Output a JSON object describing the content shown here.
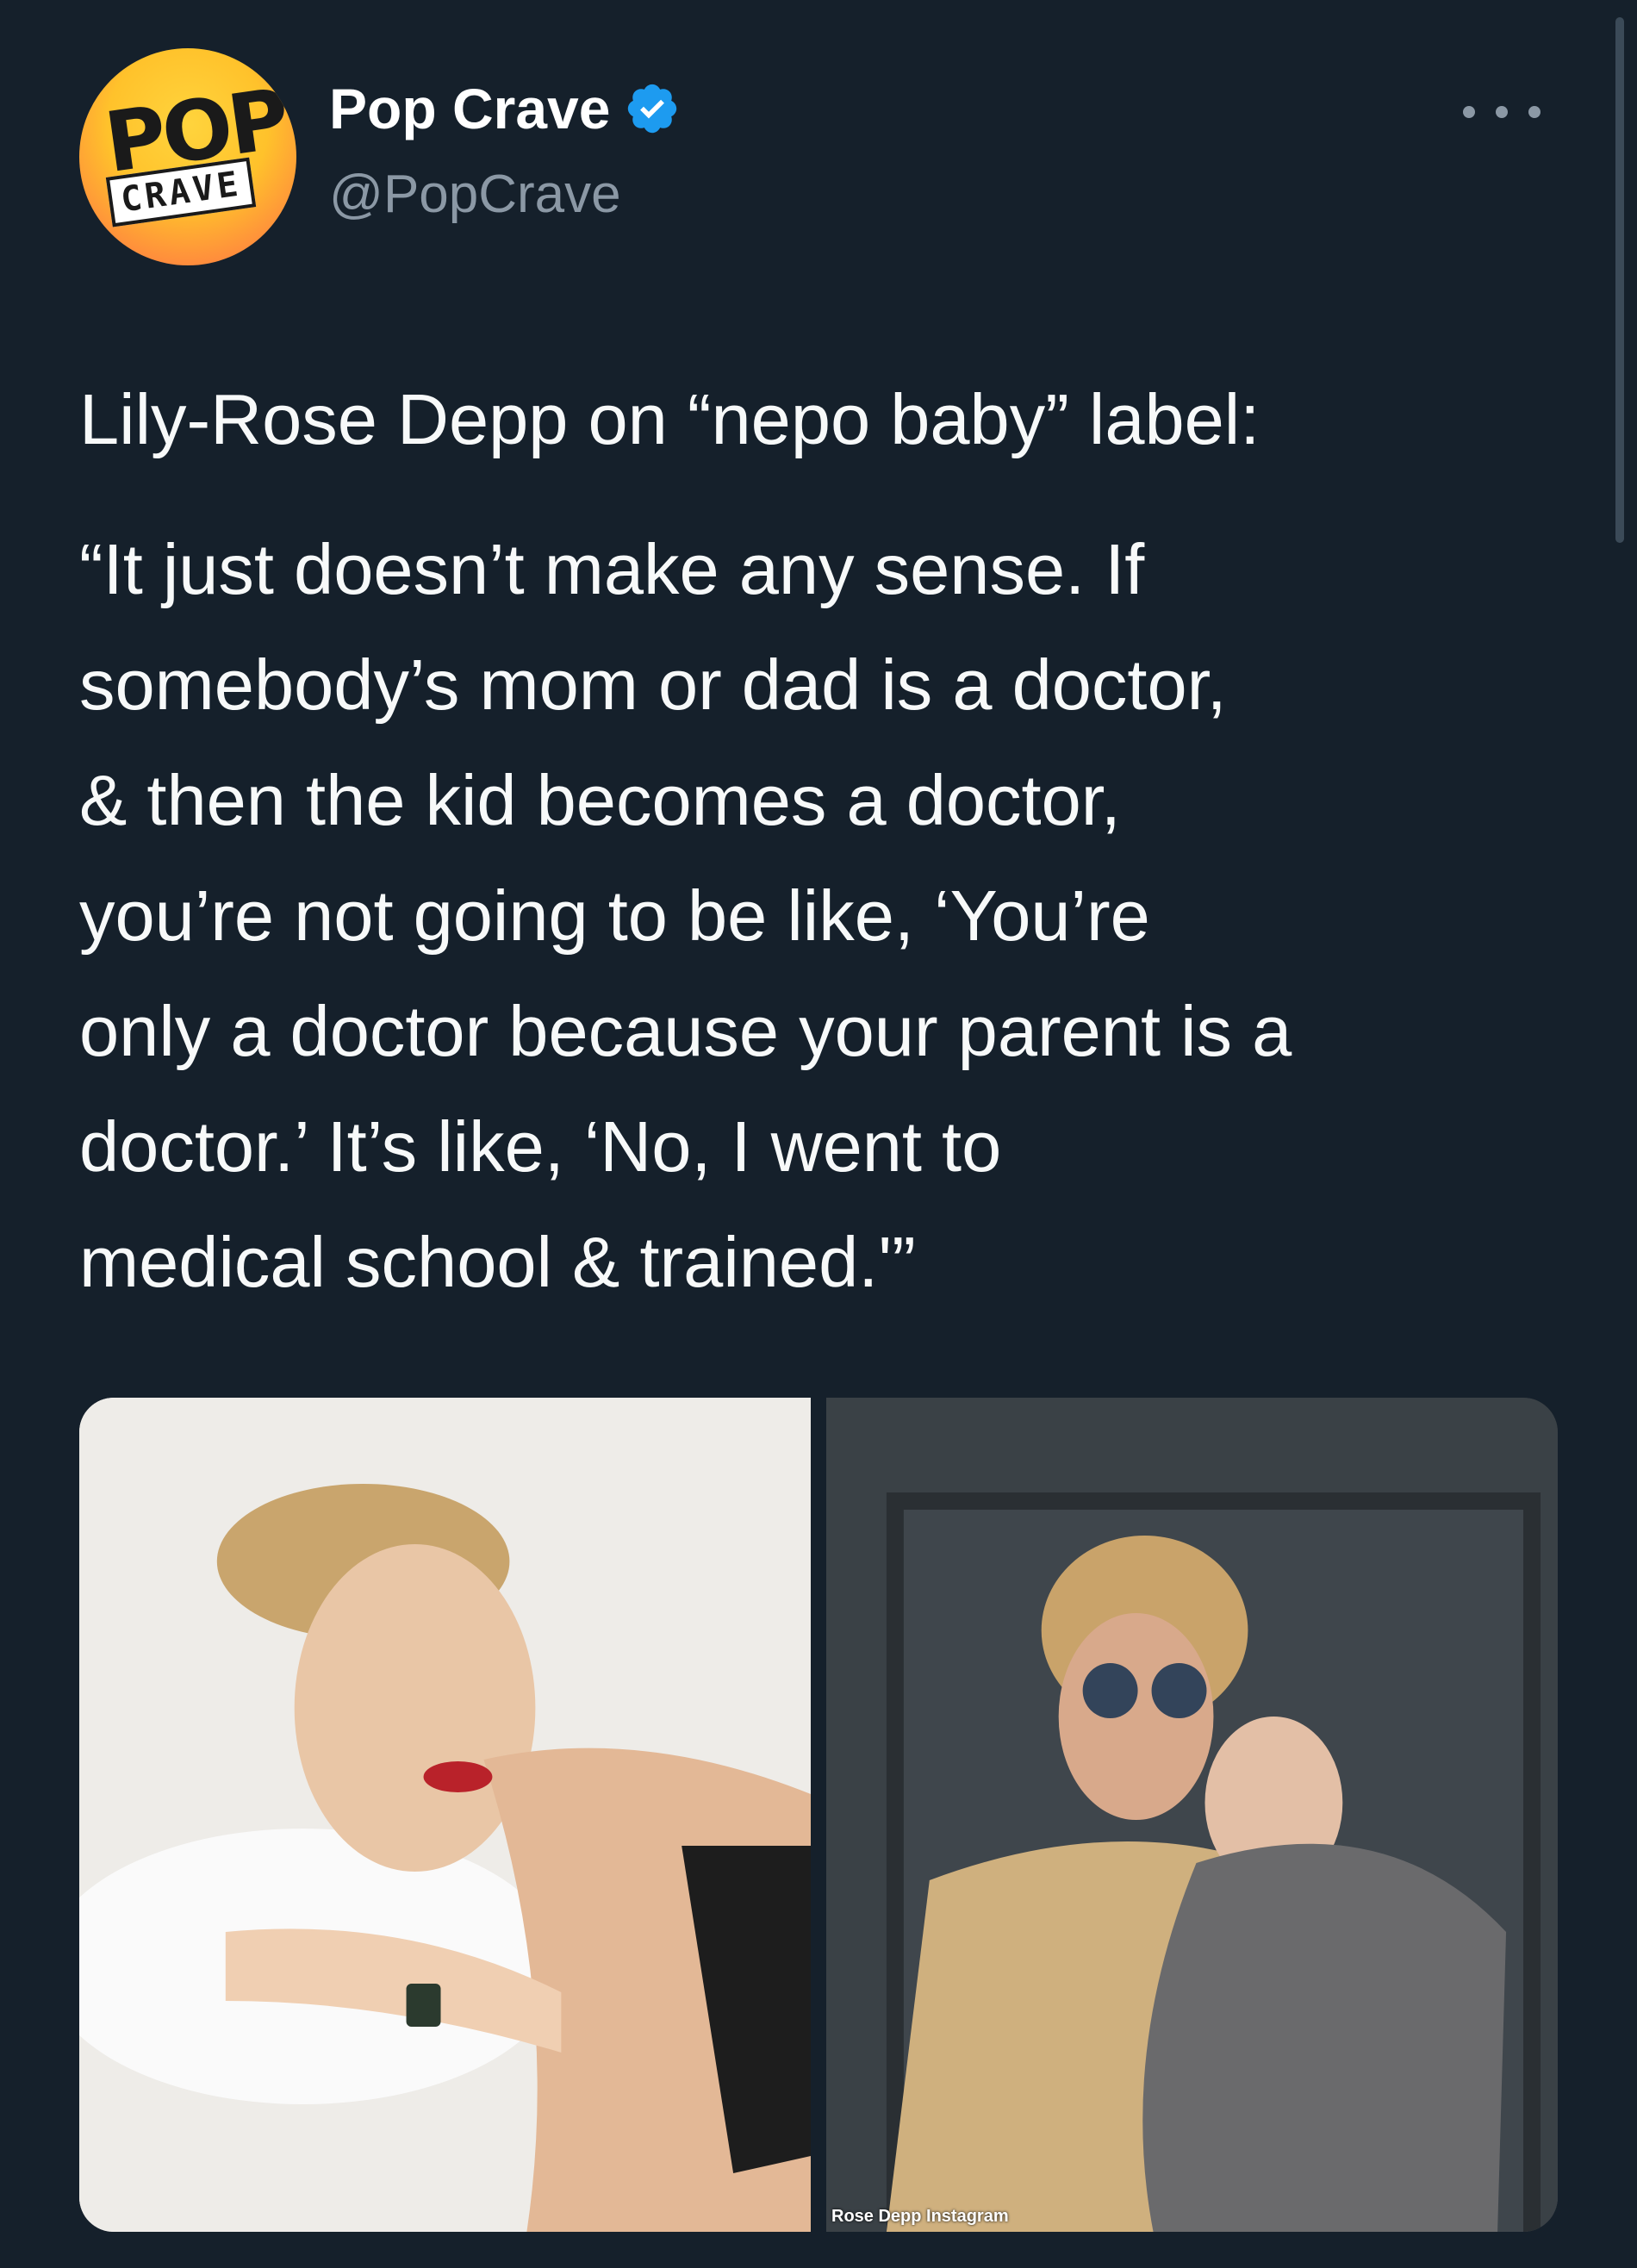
{
  "author": {
    "display_name": "Pop Crave",
    "handle": "@PopCrave",
    "avatar_text_top": "POP",
    "avatar_text_bottom": "CRAVE",
    "verified": true
  },
  "tweet": {
    "lead": "Lily-Rose Depp on “nepo baby” label:",
    "quote": "“It just doesn’t make any sense. If\nsomebody’s mom or dad is a doctor,\n& then the kid becomes a doctor,\nyou’re not going to be like, ‘You’re\nonly a doctor because your parent is a\ndoctor.’ It’s like, ‘No, I went to\nmedical school & trained.'”"
  },
  "media": {
    "right_photo_caption": "Rose Depp Instagram"
  },
  "icons": {
    "verified": "verified-badge-icon",
    "more": "more-options-icon"
  },
  "colors": {
    "background": "#15202b",
    "text": "#f7f9f9",
    "secondary_text": "#8b98a5",
    "verified_blue": "#1d9bf0"
  }
}
